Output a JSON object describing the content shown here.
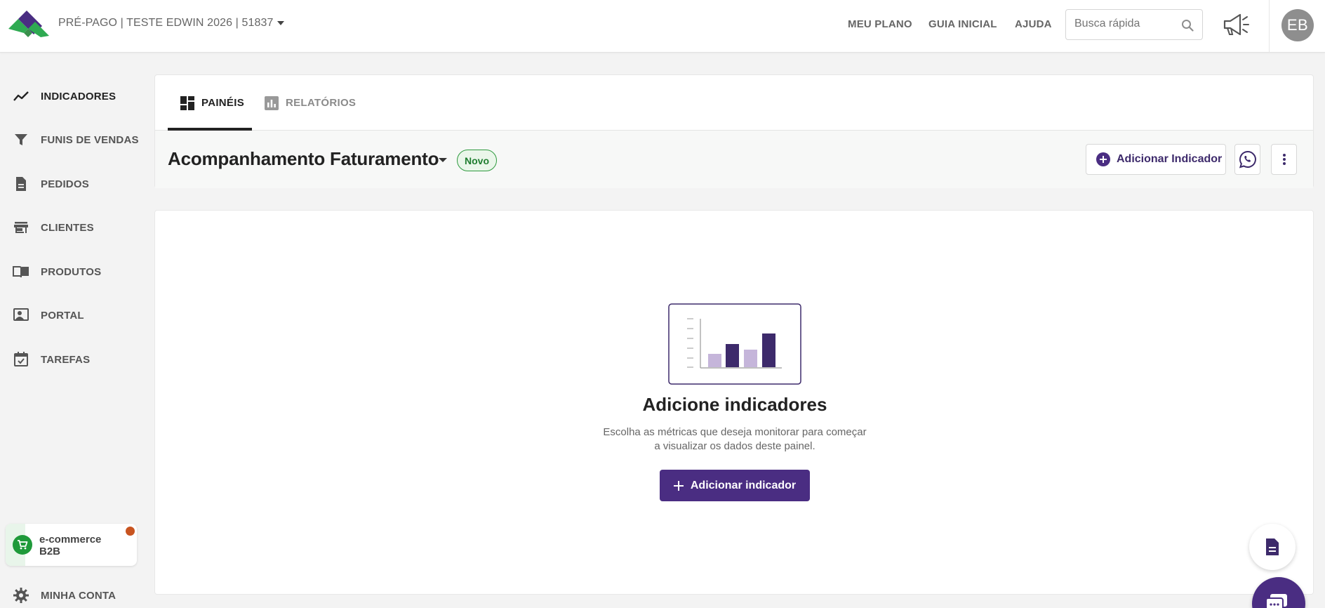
{
  "header": {
    "account_label": "PRÉ-PAGO | TESTE EDWIN 2026 | 51837",
    "nav": [
      "MEU PLANO",
      "GUIA INICIAL",
      "AJUDA"
    ],
    "search_placeholder": "Busca rápida",
    "avatar_initials": "EB"
  },
  "sidebar": {
    "items": [
      {
        "label": "INDICADORES",
        "icon": "trend-line-icon"
      },
      {
        "label": "FUNIS DE VENDAS",
        "icon": "funnel-icon"
      },
      {
        "label": "PEDIDOS",
        "icon": "document-icon"
      },
      {
        "label": "CLIENTES",
        "icon": "store-icon"
      },
      {
        "label": "PRODUTOS",
        "icon": "book-icon"
      },
      {
        "label": "PORTAL",
        "icon": "portal-user-icon"
      },
      {
        "label": "TAREFAS",
        "icon": "calendar-check-icon"
      }
    ],
    "ecommerce_line1": "e-commerce",
    "ecommerce_line2": "B2B",
    "account_label": "MINHA CONTA"
  },
  "tabs": [
    {
      "label": "PAINÉIS",
      "active": true
    },
    {
      "label": "RELATÓRIOS",
      "active": false
    }
  ],
  "dashboard": {
    "title": "Acompanhamento Faturamento",
    "badge": "Novo",
    "add_button": "Adicionar Indicador"
  },
  "empty_state": {
    "title": "Adicione indicadores",
    "desc_line1": "Escolha as métricas que deseja monitorar para começar",
    "desc_line2": "a visualizar os dados deste painel.",
    "button": "Adicionar indicador"
  },
  "colors": {
    "primary": "#4a2d82",
    "success": "#1f9a3a",
    "notification": "#c85420"
  }
}
